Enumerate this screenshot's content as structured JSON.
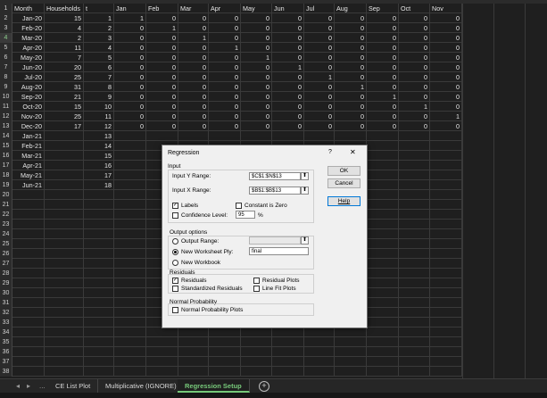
{
  "columns": [
    "Month",
    "Households",
    "t",
    "Jan",
    "Feb",
    "Mar",
    "Apr",
    "May",
    "Jun",
    "Jul",
    "Aug",
    "Sep",
    "Oct",
    "Nov"
  ],
  "rows": [
    {
      "n": "2",
      "cells": [
        "Jan-20",
        "15",
        "1",
        "1",
        "0",
        "0",
        "0",
        "0",
        "0",
        "0",
        "0",
        "0",
        "0",
        "0"
      ]
    },
    {
      "n": "3",
      "cells": [
        "Feb-20",
        "4",
        "2",
        "0",
        "1",
        "0",
        "0",
        "0",
        "0",
        "0",
        "0",
        "0",
        "0",
        "0"
      ]
    },
    {
      "n": "4",
      "cells": [
        "Mar-20",
        "2",
        "3",
        "0",
        "0",
        "1",
        "0",
        "0",
        "0",
        "0",
        "0",
        "0",
        "0",
        "0"
      ]
    },
    {
      "n": "5",
      "cells": [
        "Apr-20",
        "11",
        "4",
        "0",
        "0",
        "0",
        "1",
        "0",
        "0",
        "0",
        "0",
        "0",
        "0",
        "0"
      ]
    },
    {
      "n": "6",
      "cells": [
        "May-20",
        "7",
        "5",
        "0",
        "0",
        "0",
        "0",
        "1",
        "0",
        "0",
        "0",
        "0",
        "0",
        "0"
      ]
    },
    {
      "n": "7",
      "cells": [
        "Jun-20",
        "20",
        "6",
        "0",
        "0",
        "0",
        "0",
        "0",
        "1",
        "0",
        "0",
        "0",
        "0",
        "0"
      ]
    },
    {
      "n": "8",
      "cells": [
        "Jul-20",
        "25",
        "7",
        "0",
        "0",
        "0",
        "0",
        "0",
        "0",
        "1",
        "0",
        "0",
        "0",
        "0"
      ]
    },
    {
      "n": "9",
      "cells": [
        "Aug-20",
        "31",
        "8",
        "0",
        "0",
        "0",
        "0",
        "0",
        "0",
        "0",
        "1",
        "0",
        "0",
        "0"
      ]
    },
    {
      "n": "10",
      "cells": [
        "Sep-20",
        "21",
        "9",
        "0",
        "0",
        "0",
        "0",
        "0",
        "0",
        "0",
        "0",
        "1",
        "0",
        "0"
      ]
    },
    {
      "n": "11",
      "cells": [
        "Oct-20",
        "15",
        "10",
        "0",
        "0",
        "0",
        "0",
        "0",
        "0",
        "0",
        "0",
        "0",
        "1",
        "0"
      ]
    },
    {
      "n": "12",
      "cells": [
        "Nov-20",
        "25",
        "11",
        "0",
        "0",
        "0",
        "0",
        "0",
        "0",
        "0",
        "0",
        "0",
        "0",
        "1"
      ]
    },
    {
      "n": "13",
      "cells": [
        "Dec-20",
        "17",
        "12",
        "0",
        "0",
        "0",
        "0",
        "0",
        "0",
        "0",
        "0",
        "0",
        "0",
        "0"
      ]
    },
    {
      "n": "14",
      "cells": [
        "Jan-21",
        "",
        "13",
        "",
        "",
        "",
        "",
        "",
        "",
        "",
        "",
        "",
        "",
        ""
      ]
    },
    {
      "n": "15",
      "cells": [
        "Feb-21",
        "",
        "14",
        "",
        "",
        "",
        "",
        "",
        "",
        "",
        "",
        "",
        "",
        ""
      ]
    },
    {
      "n": "16",
      "cells": [
        "Mar-21",
        "",
        "15",
        "",
        "",
        "",
        "",
        "",
        "",
        "",
        "",
        "",
        "",
        ""
      ]
    },
    {
      "n": "17",
      "cells": [
        "Apr-21",
        "",
        "16",
        "",
        "",
        "",
        "",
        "",
        "",
        "",
        "",
        "",
        "",
        ""
      ]
    },
    {
      "n": "18",
      "cells": [
        "May-21",
        "",
        "17",
        "",
        "",
        "",
        "",
        "",
        "",
        "",
        "",
        "",
        "",
        ""
      ]
    },
    {
      "n": "19",
      "cells": [
        "Jun-21",
        "",
        "18",
        "",
        "",
        "",
        "",
        "",
        "",
        "",
        "",
        "",
        "",
        ""
      ]
    },
    {
      "n": "20",
      "cells": []
    },
    {
      "n": "21",
      "cells": []
    },
    {
      "n": "22",
      "cells": []
    },
    {
      "n": "23",
      "cells": []
    },
    {
      "n": "24",
      "cells": []
    },
    {
      "n": "25",
      "cells": []
    },
    {
      "n": "26",
      "cells": []
    },
    {
      "n": "27",
      "cells": []
    },
    {
      "n": "28",
      "cells": []
    },
    {
      "n": "29",
      "cells": []
    },
    {
      "n": "30",
      "cells": []
    },
    {
      "n": "31",
      "cells": []
    },
    {
      "n": "32",
      "cells": []
    },
    {
      "n": "33",
      "cells": []
    },
    {
      "n": "34",
      "cells": []
    },
    {
      "n": "35",
      "cells": []
    },
    {
      "n": "36",
      "cells": []
    },
    {
      "n": "37",
      "cells": []
    },
    {
      "n": "38",
      "cells": []
    }
  ],
  "header_row_number": "1",
  "tabs": [
    "CE List Plot",
    "Multiplicative (IGNORE)",
    "Regression Setup"
  ],
  "active_tab": "Regression Setup",
  "nav": {
    "prev": "◂",
    "next": "▸",
    "ellipsis": "...",
    "add": "+"
  },
  "dialog": {
    "title": "Regression",
    "help_glyph": "?",
    "close_glyph": "✕",
    "input_group": "Input",
    "input_y_label": "Input Y Range:",
    "input_y_value": "$C$1:$N$13",
    "input_x_label": "Input X Range:",
    "input_x_value": "$B$1:$B$13",
    "labels": "Labels",
    "constant_zero": "Constant is Zero",
    "confidence_level": "Confidence Level:",
    "confidence_value": "95",
    "percent": "%",
    "output_group": "Output options",
    "output_range": "Output Range:",
    "new_ply": "New Worksheet Ply:",
    "new_ply_value": "final",
    "new_workbook": "New Workbook",
    "residuals_group": "Residuals",
    "residuals": "Residuals",
    "std_residuals": "Standardized Residuals",
    "residual_plots": "Residual Plots",
    "line_fit_plots": "Line Fit Plots",
    "normal_group": "Normal Probability",
    "normal_plots": "Normal Probability Plots",
    "ok": "OK",
    "cancel": "Cancel",
    "help": "Help",
    "collapse_glyph": "⬆",
    "check_glyph": "✓"
  },
  "colors": {
    "accent": "#77c97a",
    "sheet_bg": "#1f1f1f",
    "dialog_bg": "#f0f0f0"
  }
}
